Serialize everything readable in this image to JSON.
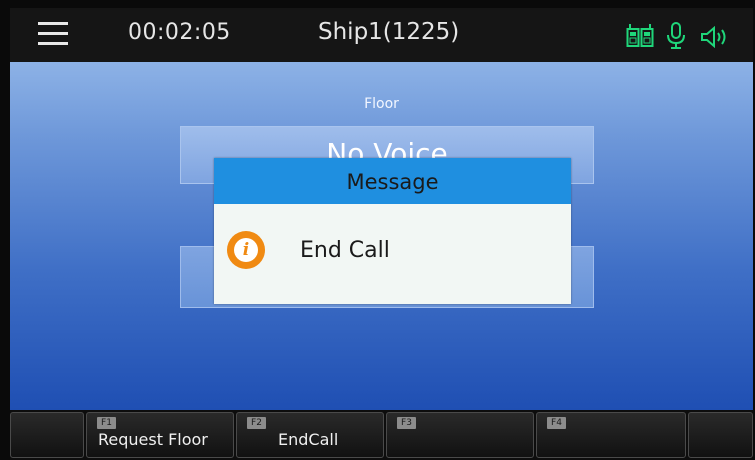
{
  "status_bar": {
    "menu_icon": "hamburger-menu-icon",
    "duration": "00:02:05",
    "call_name": "Ship1(1225)",
    "status_icons": [
      "walkie-talkie-icon",
      "microphone-icon",
      "speaker-icon"
    ],
    "icon_color": "#1fd67a"
  },
  "main": {
    "floor_label": "Floor",
    "voice_status": "No Voice",
    "background_top": "#8db2e6",
    "background_bottom": "#1f4fb3"
  },
  "dialog": {
    "title": "Message",
    "icon": "info-icon",
    "message": "End Call",
    "header_color": "#1f8fe0",
    "icon_color": "#f08a12"
  },
  "softkeys": [
    {
      "key": "",
      "label": ""
    },
    {
      "key": "F1",
      "label": "Request Floor"
    },
    {
      "key": "F2",
      "label": "EndCall"
    },
    {
      "key": "F3",
      "label": ""
    },
    {
      "key": "F4",
      "label": ""
    },
    {
      "key": "",
      "label": ""
    }
  ]
}
